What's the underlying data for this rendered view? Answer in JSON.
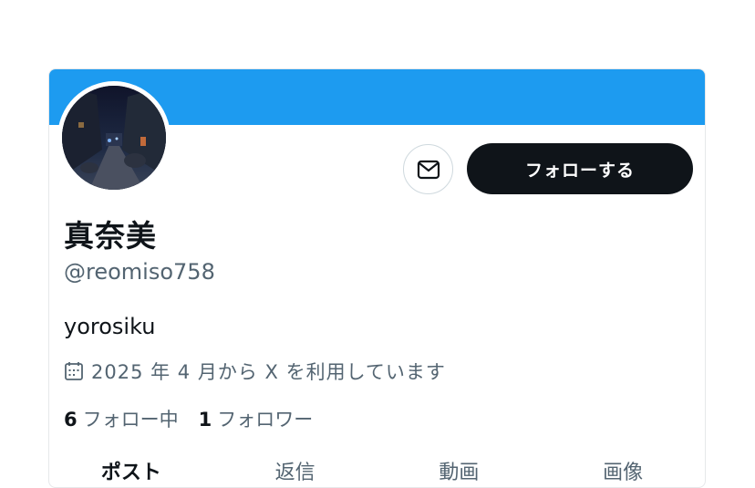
{
  "colors": {
    "banner": "#1d9bf0",
    "follow_button_bg": "#0f1419",
    "secondary_text": "#536471"
  },
  "profile": {
    "display_name": "真奈美",
    "handle": "@reomiso758",
    "bio": "yorosiku",
    "joined": "2025 年 4 月から X を利用しています"
  },
  "actions": {
    "message_icon": "envelope-icon",
    "follow_label": "フォローする"
  },
  "stats": {
    "following_count": "6",
    "following_label": "フォロー中",
    "followers_count": "1",
    "followers_label": "フォロワー"
  },
  "tabs": [
    {
      "label": "ポスト",
      "active": true
    },
    {
      "label": "返信",
      "active": false
    },
    {
      "label": "動画",
      "active": false
    },
    {
      "label": "画像",
      "active": false
    }
  ]
}
